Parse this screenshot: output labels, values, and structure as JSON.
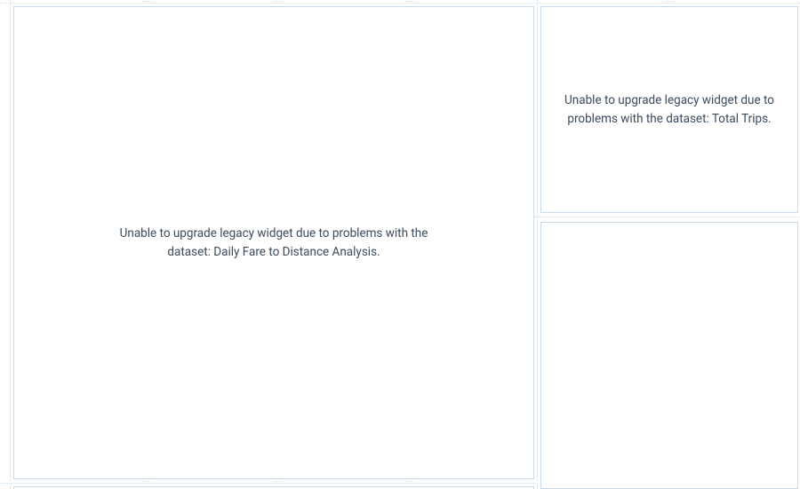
{
  "widgets": {
    "left": {
      "error_message": "Unable to upgrade legacy widget due to problems with the dataset: Daily Fare to Distance Analysis."
    },
    "top_right": {
      "error_message": "Unable to upgrade legacy widget due to problems with the dataset: Total Trips."
    },
    "bottom_right": {
      "error_message": ""
    }
  }
}
